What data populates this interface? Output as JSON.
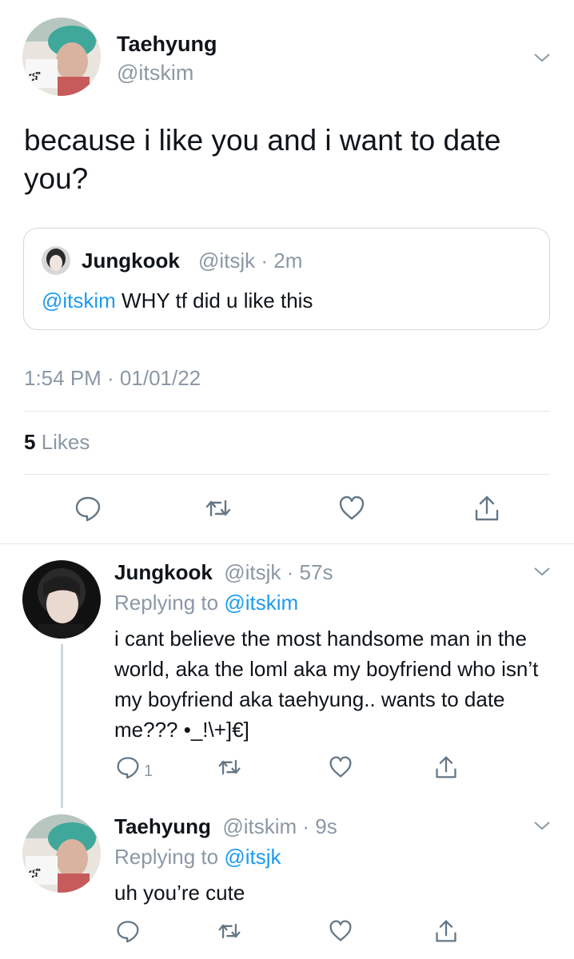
{
  "main_tweet": {
    "name": "Taehyung",
    "handle": "@itskim",
    "text": "because i like you and i want to date you?",
    "quote": {
      "name": "Jungkook",
      "handle_time": "@itsjk · 2m",
      "mention": "@itskim",
      "text": " WHY tf did u like this"
    },
    "timestamp": "1:54 PM · 01/01/22",
    "likes_count": "5",
    "likes_label": " Likes"
  },
  "replies": [
    {
      "name": "Jungkook",
      "handle_time": "@itsjk · 57s",
      "replying_prefix": "Replying to ",
      "replying_to": "@itskim",
      "text": "i cant believe the most handsome man in the world, aka the loml aka my boyfriend who isn’t my boyfriend aka taehyung.. wants to date me??? •_!\\+]€]",
      "reply_count": "1"
    },
    {
      "name": "Taehyung",
      "handle_time": "@itskim · 9s",
      "replying_prefix": "Replying to ",
      "replying_to": "@itsjk",
      "text": "uh you’re cute"
    }
  ],
  "colors": {
    "accent": "#1d9bf0",
    "muted": "#8b98a5",
    "divider": "#e1e8ed"
  },
  "icons": [
    "chevron-down-icon",
    "reply-icon",
    "retweet-icon",
    "like-icon",
    "share-icon"
  ]
}
